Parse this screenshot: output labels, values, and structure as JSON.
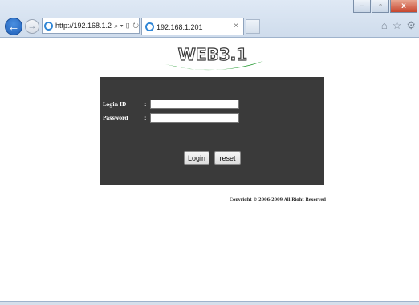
{
  "browser": {
    "address_text": "http://192.168.1.2...",
    "address_tools": "⌕ ▾ ▯ ↻",
    "tab_title": "192.168.1.201",
    "tab_close": "×",
    "window_buttons": {
      "minimize": "–",
      "maximize": "▫",
      "close": "x"
    },
    "right_icons": {
      "home": "⌂",
      "favorites": "☆",
      "settings": "⚙"
    },
    "back": "←",
    "forward": "→"
  },
  "page": {
    "logo_text": "WEB3.1",
    "login": {
      "login_id_label": "Login ID",
      "password_label": "Password",
      "colon": ":",
      "login_id_value": "",
      "password_value": "",
      "login_button": "Login",
      "reset_button": "reset"
    },
    "copyright": "Copyright © 2006-2009 All Right Reserved"
  },
  "colors": {
    "panel_bg": "#3a3a3a",
    "logo_green": "#2e9e3a",
    "chrome_bg": "#dfe9f5"
  }
}
